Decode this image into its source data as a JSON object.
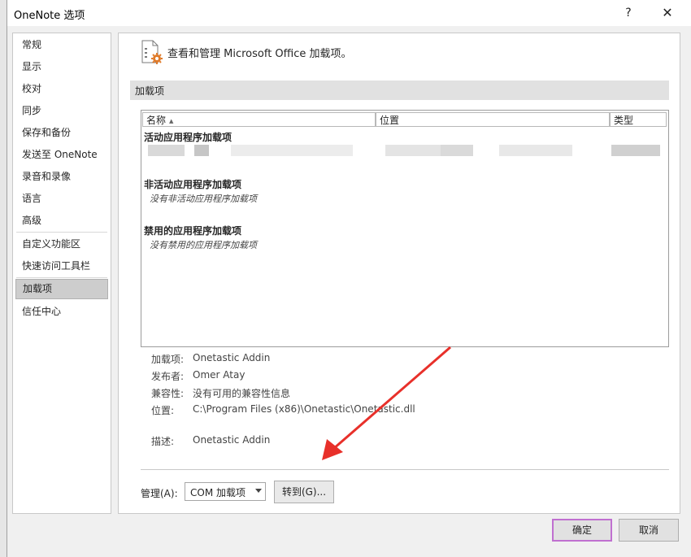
{
  "window": {
    "title": "OneNote 选项",
    "help_glyph": "?",
    "close_glyph": "✕"
  },
  "nav": {
    "items": [
      "常规",
      "显示",
      "校对",
      "同步",
      "保存和备份",
      "发送至 OneNote",
      "录音和录像",
      "语言",
      "高级",
      "自定义功能区",
      "快速访问工具栏",
      "加载项",
      "信任中心"
    ],
    "selected": "加载项"
  },
  "header": {
    "text": "查看和管理 Microsoft Office 加载项。",
    "icon": "addins-gear-icon"
  },
  "section": {
    "title": "加载项"
  },
  "list": {
    "columns": [
      "名称",
      "位置",
      "类型"
    ],
    "sorted_column": "名称",
    "groups": [
      {
        "title": "活动应用程序加载项",
        "empty_text": ""
      },
      {
        "title": "非活动应用程序加载项",
        "empty_text": "没有非活动应用程序加载项"
      },
      {
        "title": "禁用的应用程序加载项",
        "empty_text": "没有禁用的应用程序加载项"
      }
    ]
  },
  "details": {
    "addin_label": "加载项:",
    "addin_value": "Onetastic Addin",
    "publisher_label": "发布者:",
    "publisher_value": "Omer Atay",
    "compat_label": "兼容性:",
    "compat_value": "没有可用的兼容性信息",
    "location_label": "位置:",
    "location_value": "C:\\Program Files (x86)\\Onetastic\\Onetastic.dll",
    "desc_label": "描述:",
    "desc_value": "Onetastic Addin"
  },
  "manage": {
    "label": "管理(A):",
    "selected": "COM 加载项",
    "go_button": "转到(G)..."
  },
  "footer": {
    "ok": "确定",
    "cancel": "取消"
  },
  "colors": {
    "annotation_arrow": "#e8302a",
    "selected_nav": "#cdcdcd",
    "section_band": "#e1e1e1"
  }
}
